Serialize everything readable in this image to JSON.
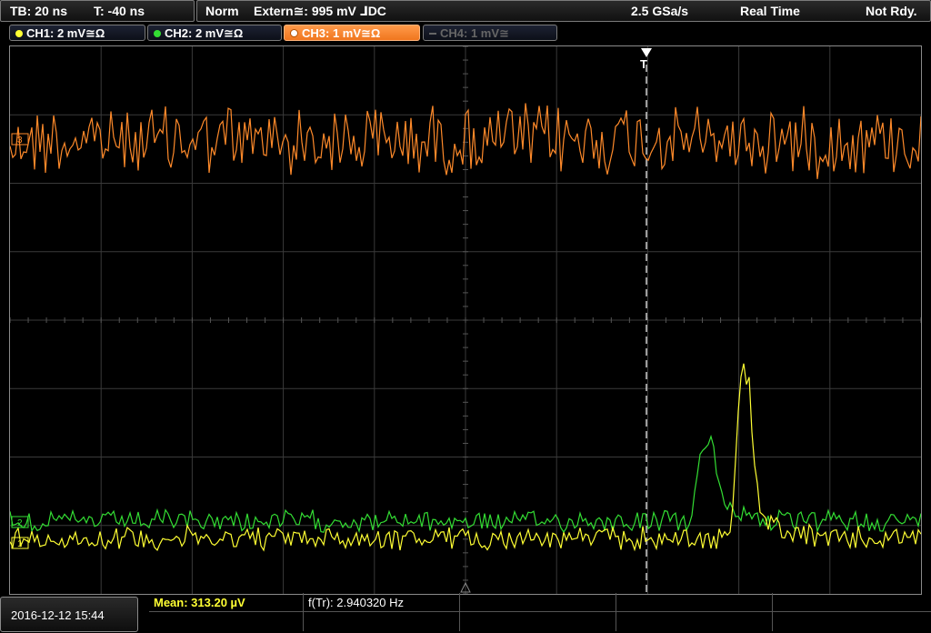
{
  "topbar": {
    "timebase": "TB: 20 ns",
    "trigger_time": "T: -40 ns",
    "trigger_mode": "Norm",
    "trigger_source": "Extern≅: 995 mV ⅃DC",
    "sample_rate": "2.5 GSa/s",
    "acq_mode": "Real Time",
    "status": "Not Rdy."
  },
  "channels": [
    {
      "label": "CH1: 2 mV≅Ω",
      "color": "#ffff33"
    },
    {
      "label": "CH2: 2 mV≅Ω",
      "color": "#33dd33"
    },
    {
      "label": "CH3: 1 mV≅Ω",
      "color": "#ff8a2a"
    },
    {
      "label": "CH4: 1 mV≅",
      "color": "#666666"
    }
  ],
  "markers": {
    "trigger": "T",
    "ch3_level": "3",
    "ch2_level": "2",
    "ch1_level": "1"
  },
  "measure": {
    "mean": "Mean: 313.20 µV",
    "freq": "f(Tr): 2.940320 Hz"
  },
  "datetime": "2016-12-12 15:44",
  "colors": {
    "ch1": "#ffff33",
    "ch2": "#33dd33",
    "ch3": "#ff8a2a",
    "grid": "#3a3a3a"
  }
}
